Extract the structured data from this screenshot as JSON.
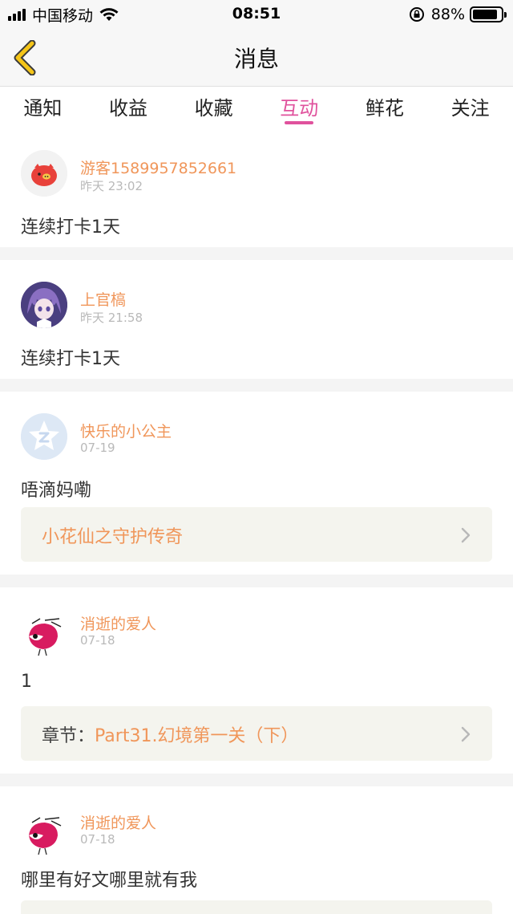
{
  "status_bar": {
    "carrier": "中国移动",
    "time": "08:51",
    "battery_percent": "88%",
    "battery_level": 0.88,
    "icons": [
      "signal-icon",
      "wifi-icon",
      "rotation-lock-icon",
      "battery-icon"
    ]
  },
  "nav": {
    "title": "消息",
    "back_icon": "chevron-left-icon"
  },
  "tabs": [
    {
      "label": "通知"
    },
    {
      "label": "收益"
    },
    {
      "label": "收藏"
    },
    {
      "label": "互动"
    },
    {
      "label": "鲜花"
    },
    {
      "label": "关注"
    }
  ],
  "active_tab": "互动",
  "messages": [
    {
      "user": "游客1589957852661",
      "time": "昨天 23:02",
      "text": "连续打卡1天"
    },
    {
      "user": "上官槁",
      "time": "昨天 21:58",
      "text": "连续打卡1天"
    },
    {
      "user": "快乐的小公主",
      "time": "07-19",
      "text": "唔滴妈嘞",
      "ref_title": "小花仙之守护传奇"
    },
    {
      "user": "消逝的爱人",
      "time": "07-18",
      "text": "1",
      "ref_prefix": "章节：",
      "ref_title": "Part31.幻境第一关（下）"
    },
    {
      "user": "消逝的爱人",
      "time": "07-18",
      "text": "哪里有好文哪里就有我"
    }
  ],
  "colors": {
    "accent": "#e0529d",
    "username": "#f0965a",
    "timestamp": "#b9b9b9",
    "ref_background": "#f4f4ee",
    "back_arrow": "#f5c518"
  }
}
